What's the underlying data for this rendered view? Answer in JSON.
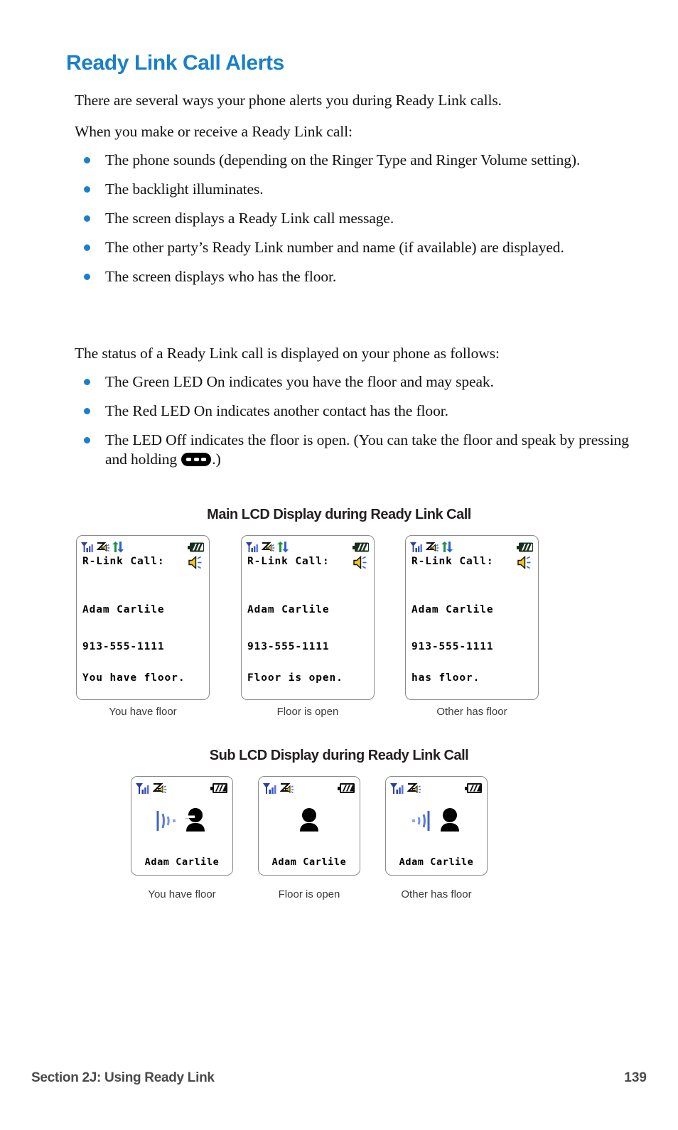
{
  "page": {
    "title": "Ready Link Call Alerts",
    "title_color": "#1a7fc9",
    "bullet_color": "#1a7fc9"
  },
  "intro": {
    "paragraph_1": "There are several ways your phone alerts you during Ready Link calls.",
    "paragraph_2": "When you make or receive a Ready Link call:"
  },
  "alerts_bullets": [
    {
      "text": "The phone sounds (depending on the Ringer Type and Ringer Volume setting)."
    },
    {
      "text": "The backlight illuminates."
    },
    {
      "text": "The screen displays a Ready Link call message."
    },
    {
      "text": "The other party’s Ready Link number and name (if available) are displayed."
    },
    {
      "text": "The screen displays who has the floor."
    }
  ],
  "status": {
    "intro": "The status of a Ready Link call is displayed on your phone as follows:",
    "bullets": [
      {
        "text": "The Green LED On indicates you have the floor and may speak."
      },
      {
        "text": "The Red LED On indicates another contact has the floor."
      }
    ],
    "last_bullet_before_key": "The LED Off indicates the floor is open. (You can take the floor and speak by pressing and holding ",
    "last_bullet_after_key": ".)"
  },
  "main_lcd": {
    "heading": "Main LCD Display during Ready Link Call",
    "screens": [
      {
        "title": "R-Link Call:",
        "name": "Adam Carlile",
        "number": "913-555-1111",
        "status": "You have floor.",
        "caption": "You have floor"
      },
      {
        "title": "R-Link Call:",
        "name": "Adam Carlile",
        "number": "913-555-1111",
        "status": "Floor is open.",
        "caption": "Floor is open"
      },
      {
        "title": "R-Link Call:",
        "name": "Adam Carlile",
        "number": "913-555-1111",
        "status": "has floor.",
        "caption": "Other has floor"
      }
    ]
  },
  "sub_lcd": {
    "heading": "Sub LCD Display during Ready Link Call",
    "screens": [
      {
        "name": "Adam Carlile",
        "caption": "You have floor",
        "figure": "person-speaking-outgoing-icon"
      },
      {
        "name": "Adam Carlile",
        "caption": "Floor is open",
        "figure": "person-idle-icon"
      },
      {
        "name": "Adam Carlile",
        "caption": "Other has floor",
        "figure": "person-listening-incoming-icon"
      }
    ]
  },
  "status_icons": {
    "signal": "signal-bars-icon",
    "ringer": "ringer-vibrate-icon",
    "data": "data-arrows-icon",
    "battery": "battery-icon",
    "speaker": "speakerphone-icon"
  },
  "footer": {
    "section": "Section 2J: Using Ready Link",
    "page_number": "139"
  }
}
